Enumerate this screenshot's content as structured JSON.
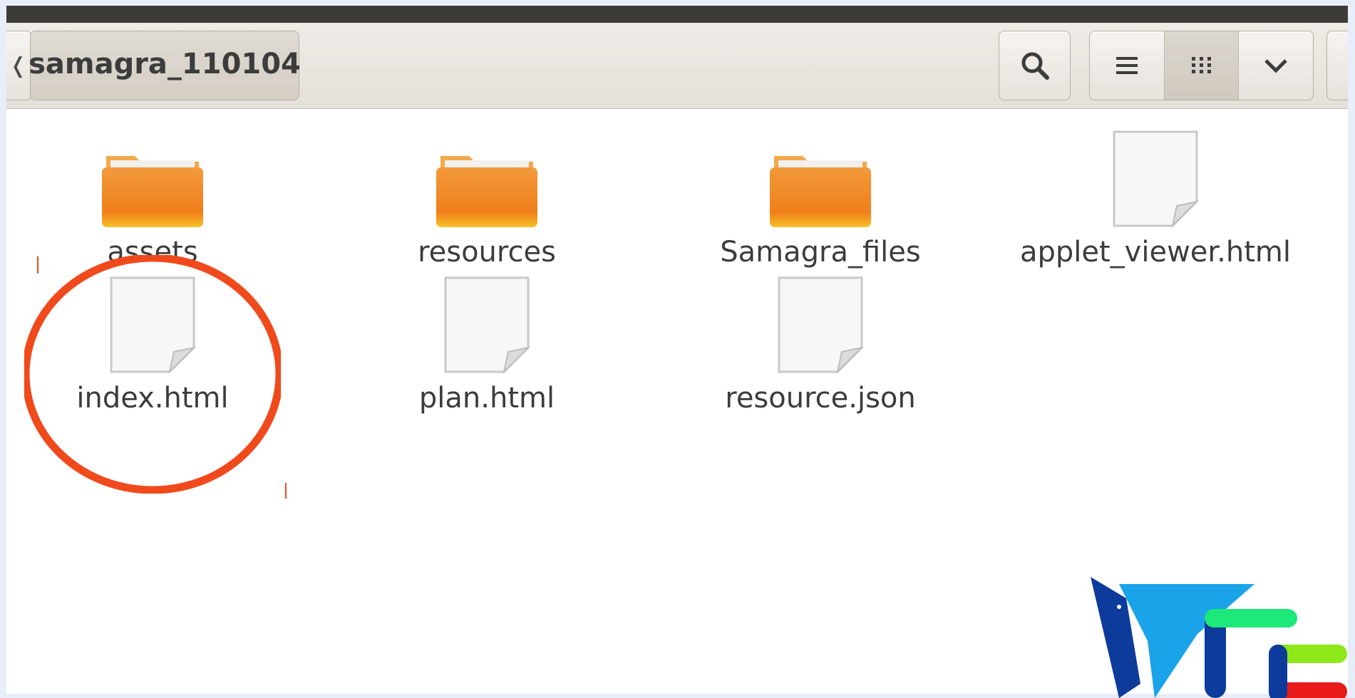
{
  "toolbar": {
    "breadcrumb_current": "samagra_110104",
    "breadcrumb_prev_icon": "chevron-left-icon",
    "search_icon": "search-icon",
    "view_buttons": [
      "list-view-icon",
      "grid-view-icon",
      "chevron-down-icon"
    ]
  },
  "files": [
    {
      "name": "assets",
      "type": "folder"
    },
    {
      "name": "resources",
      "type": "folder"
    },
    {
      "name": "Samagra_files",
      "type": "folder"
    },
    {
      "name": "applet_viewer.html",
      "type": "file"
    },
    {
      "name": "index.html",
      "type": "file",
      "highlighted": true
    },
    {
      "name": "plan.html",
      "type": "file"
    },
    {
      "name": "resource.json",
      "type": "file"
    }
  ],
  "annotation": {
    "color": "#f04a1c",
    "target": "index.html"
  },
  "colors": {
    "folder": "#f08a24",
    "folder_tab": "#f5a84a",
    "toolbar": "#e6e2dc",
    "title_bar": "#3d3b37",
    "logo_blue": "#0d3b9c",
    "logo_cyan": "#1aa3e8",
    "logo_green": "#1de87a",
    "logo_lime": "#8fe81a",
    "logo_red": "#e81a1a"
  }
}
